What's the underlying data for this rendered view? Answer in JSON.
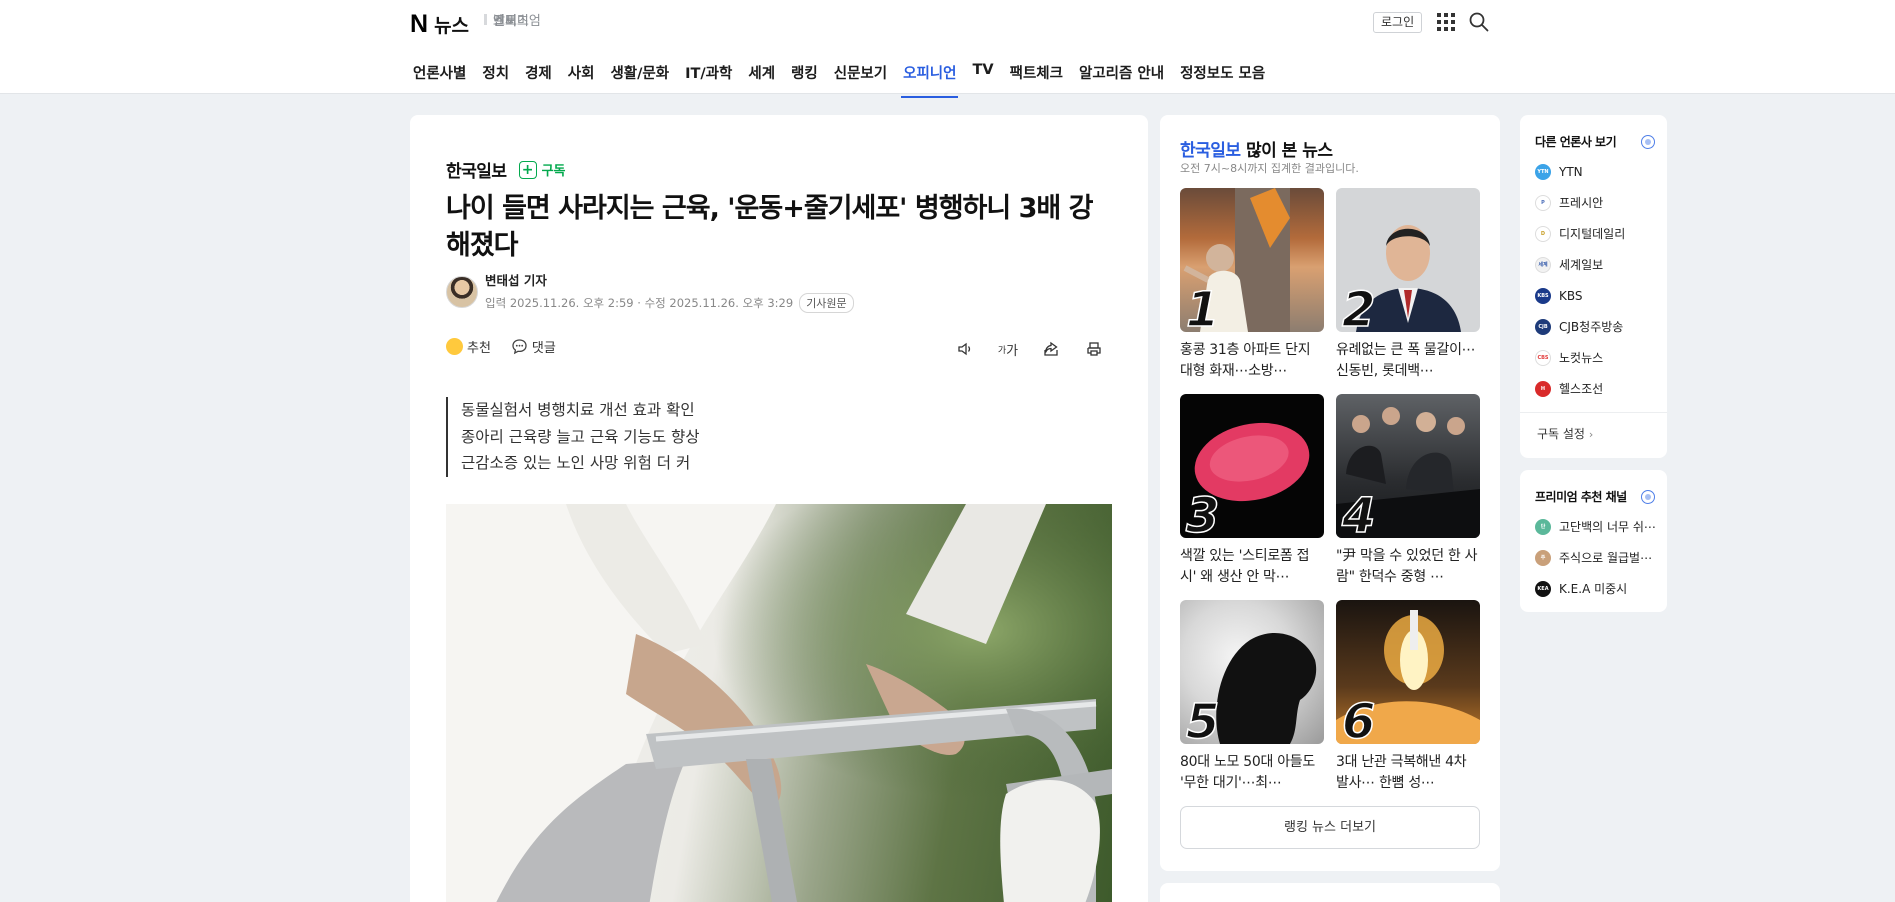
{
  "header": {
    "logo_mark": "N",
    "logo_text": "뉴스",
    "subnav": [
      "엔터",
      "스포츠",
      "날씨",
      "프리미엄"
    ],
    "login_label": "로그인"
  },
  "nav": {
    "tabs": [
      {
        "label": "언론사별"
      },
      {
        "label": "정치"
      },
      {
        "label": "경제"
      },
      {
        "label": "사회"
      },
      {
        "label": "생활/문화"
      },
      {
        "label": "IT/과학"
      },
      {
        "label": "세계"
      },
      {
        "label": "랭킹"
      },
      {
        "label": "신문보기"
      },
      {
        "label": "오피니언",
        "active": true
      },
      {
        "label": "TV"
      },
      {
        "label": "팩트체크"
      },
      {
        "label": "알고리즘 안내"
      },
      {
        "label": "정정보도 모음"
      }
    ]
  },
  "article": {
    "press": "한국일보",
    "subscribe_label": "구독",
    "headline": "나이 들면 사라지는 근육, '운동+줄기세포' 병행하니 3배 강해졌다",
    "reporter": "변태섭 기자",
    "dates": "입력 2025.11.26. 오후 2:59 · 수정 2025.11.26. 오후 3:29",
    "original_label": "기사원문",
    "like_label": "추천",
    "comment_label": "댓글",
    "font_size_label": "가",
    "summary": [
      "동물실험서 병행치료 개선 효과 확인",
      "종아리 근육량 늘고 근육 기능도 향상",
      "근감소증 있는 노인 사망 위험 더 커"
    ]
  },
  "ranking": {
    "brand": "한국일보",
    "title_suffix": "많이 본 뉴스",
    "subtitle": "오전 7시~8시까지 집계한 결과입니다.",
    "items": [
      {
        "rank": "1",
        "title": "홍콩 31층 아파트 단지 대형 화재⋯소방⋯"
      },
      {
        "rank": "2",
        "title": "유례없는 큰 폭 물갈이⋯신동빈, 롯데백⋯"
      },
      {
        "rank": "3",
        "title": "색깔 있는 '스티로폼 접시' 왜 생산 안 막⋯"
      },
      {
        "rank": "4",
        "title": "\"尹 막을 수 있었던 한 사람\" 한덕수 중형 ⋯"
      },
      {
        "rank": "5",
        "title": "80대 노모 50대 아들도 '무한 대기'⋯최⋯"
      },
      {
        "rank": "6",
        "title": "3대 난관 극복해낸 4차 발사⋯ 한뼘 성⋯"
      }
    ],
    "more_label": "랭킹 뉴스 더보기"
  },
  "other_press": {
    "title": "다른 언론사 보기",
    "items": [
      {
        "name": "YTN",
        "color": "#3ba3e8",
        "mark": "YTN"
      },
      {
        "name": "프레시안",
        "color": "#ffffff",
        "mark": "P"
      },
      {
        "name": "디지털데일리",
        "color": "#ffffff",
        "mark": "D"
      },
      {
        "name": "세계일보",
        "color": "#f2f2f2",
        "mark": "세계"
      },
      {
        "name": "KBS",
        "color": "#1a3a8a",
        "mark": "KBS"
      },
      {
        "name": "CJB청주방송",
        "color": "#1e3b7a",
        "mark": "CJB"
      },
      {
        "name": "노컷뉴스",
        "color": "#ffffff",
        "mark": "CBS"
      },
      {
        "name": "헬스조선",
        "color": "#d92a2a",
        "mark": "H"
      }
    ],
    "setting_label": "구독 설정"
  },
  "premium": {
    "title": "프리미엄 추천 채널",
    "items": [
      {
        "name": "고단백의 너무 쉬⋯",
        "color": "#5bb89a",
        "mark": "단"
      },
      {
        "name": "주식으로 월급벌⋯",
        "color": "#c9a07a",
        "mark": "주"
      },
      {
        "name": "K.E.A 미중시",
        "color": "#111111",
        "mark": "KEA"
      }
    ]
  },
  "colors": {
    "accent": "#2a5ee0",
    "subscribe_green": "#03a94d"
  }
}
